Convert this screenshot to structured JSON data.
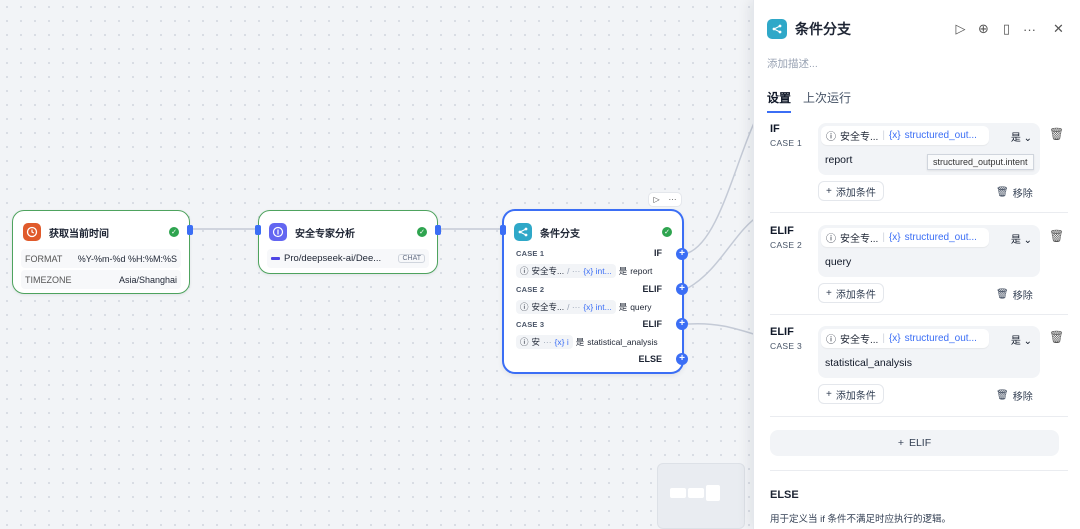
{
  "canvas": {
    "node_time": {
      "title": "获取当前时间",
      "rows": [
        {
          "key": "FORMAT",
          "value": "%Y-%m-%d %H:%M:%S"
        },
        {
          "key": "TIMEZONE",
          "value": "Asia/Shanghai"
        }
      ]
    },
    "node_expert": {
      "title": "安全专家分析",
      "model": "Pro/deepseek-ai/Dee...",
      "badge": "CHAT"
    },
    "node_branch": {
      "title": "条件分支",
      "cases": [
        {
          "label": "CASE 1",
          "kw": "IF",
          "src": "安全专...",
          "var": "{x} int...",
          "op": "是",
          "val": "report"
        },
        {
          "label": "CASE 2",
          "kw": "ELIF",
          "src": "安全专...",
          "var": "{x} int...",
          "op": "是",
          "val": "query"
        },
        {
          "label": "CASE 3",
          "kw": "ELIF",
          "src": "安",
          "var": "{x} i",
          "op": "是",
          "val": "statistical_analysis"
        }
      ],
      "else_kw": "ELSE"
    }
  },
  "panel": {
    "title": "条件分支",
    "description_placeholder": "添加描述...",
    "tabs": [
      "设置",
      "上次运行"
    ],
    "cases": [
      {
        "kw": "IF",
        "sub": "CASE 1",
        "src": "安全专...",
        "var": "structured_out...",
        "op": "是",
        "value": "report"
      },
      {
        "kw": "ELIF",
        "sub": "CASE 2",
        "src": "安全专...",
        "var": "structured_out...",
        "op": "是",
        "value": "query"
      },
      {
        "kw": "ELIF",
        "sub": "CASE 3",
        "src": "安全专...",
        "var": "structured_out...",
        "op": "是",
        "value": "statistical_analysis"
      }
    ],
    "add_condition": "添加条件",
    "remove": "移除",
    "tooltip": "structured_output.intent",
    "add_elif": "ELIF",
    "else_kw": "ELSE",
    "else_desc": "用于定义当 if 条件不满足时应执行的逻辑。"
  },
  "colors": {
    "accent": "#3b6ef5",
    "success": "#2ea44f",
    "branch_icon": "#2fa8c8",
    "time_icon": "#e05a2b",
    "expert_icon": "#6366f1"
  }
}
